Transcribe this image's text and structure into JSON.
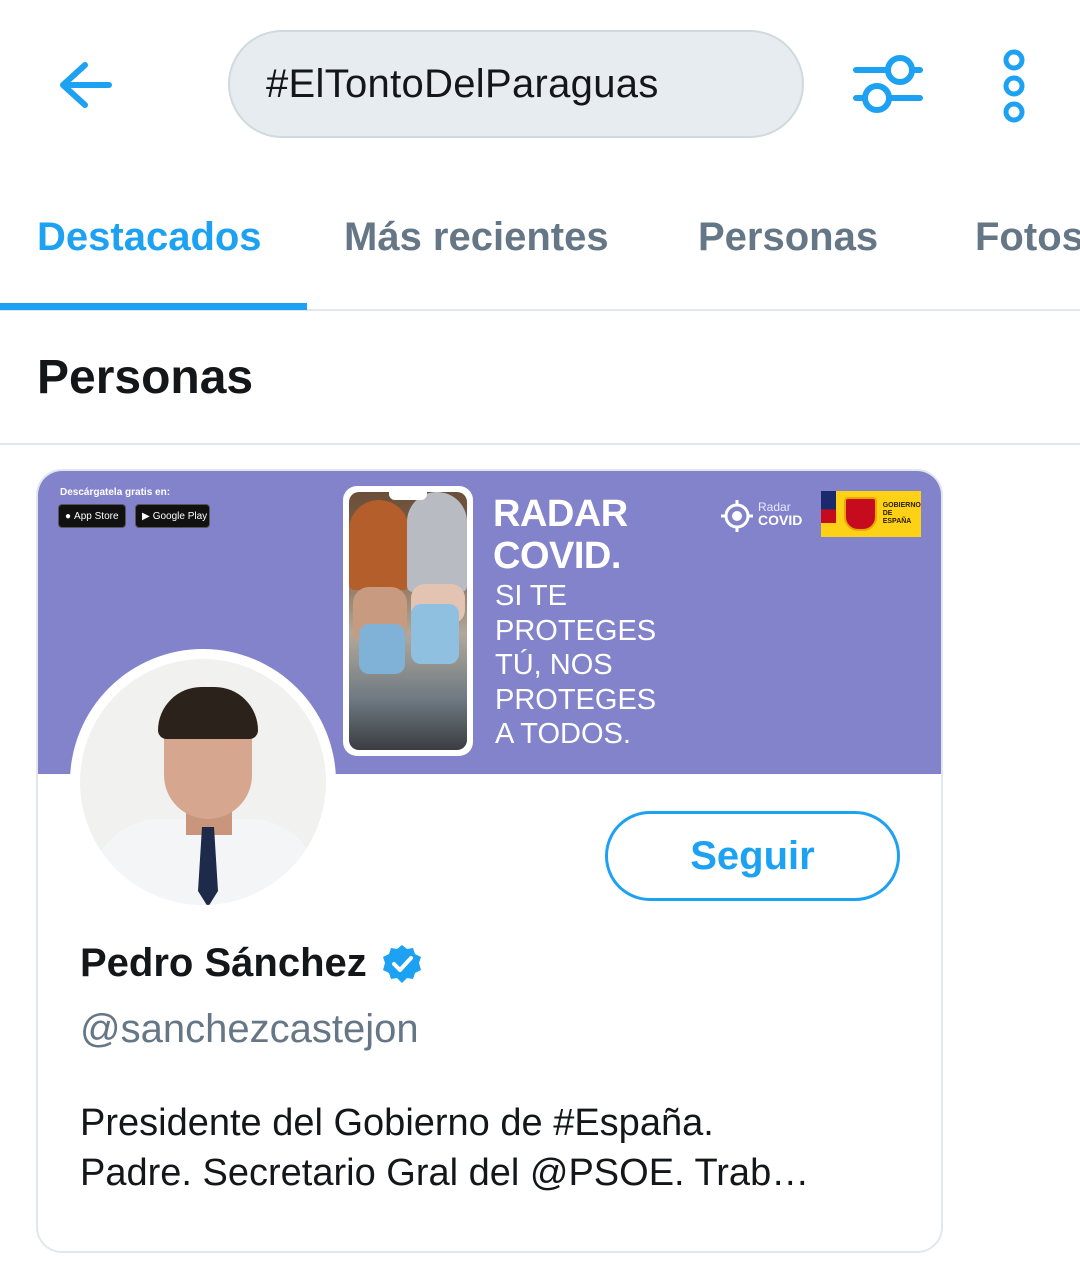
{
  "search": {
    "query": "#ElTontoDelParaguas"
  },
  "tabs": [
    {
      "label": "Destacados",
      "active": true
    },
    {
      "label": "Más recientes",
      "active": false
    },
    {
      "label": "Personas",
      "active": false
    },
    {
      "label": "Fotos",
      "active": false
    }
  ],
  "section": {
    "title": "Personas"
  },
  "user_card": {
    "banner": {
      "store_caption": "Descárgatela gratis en:",
      "app_store_label": "App Store",
      "google_play_label": "Google Play",
      "headline_line1": "RADAR",
      "headline_line2": "COVID.",
      "tagline_line1": "SI TE",
      "tagline_line2": "PROTEGES",
      "tagline_line3": "TÚ, NOS",
      "tagline_line4": "PROTEGES",
      "tagline_line5": "A TODOS.",
      "logo_word1": "Radar",
      "logo_word2": "COVID",
      "gov_line1": "GOBIERNO",
      "gov_line2": "DE ESPAÑA"
    },
    "follow_label": "Seguir",
    "name": "Pedro Sánchez",
    "verified": true,
    "handle": "@sanchezcastejon",
    "bio_line1": "Presidente del Gobierno de #España.",
    "bio_line2": "Padre. Secretario Gral del @PSOE. Trab…"
  },
  "colors": {
    "accent": "#1da1f2",
    "banner": "#8383cc",
    "search_bg": "#e6ecf0",
    "secondary_text": "#657786"
  },
  "icons": {
    "back": "arrow-left-icon",
    "filter": "sliders-icon",
    "more": "more-vertical-icon",
    "verified": "verified-badge-icon"
  }
}
